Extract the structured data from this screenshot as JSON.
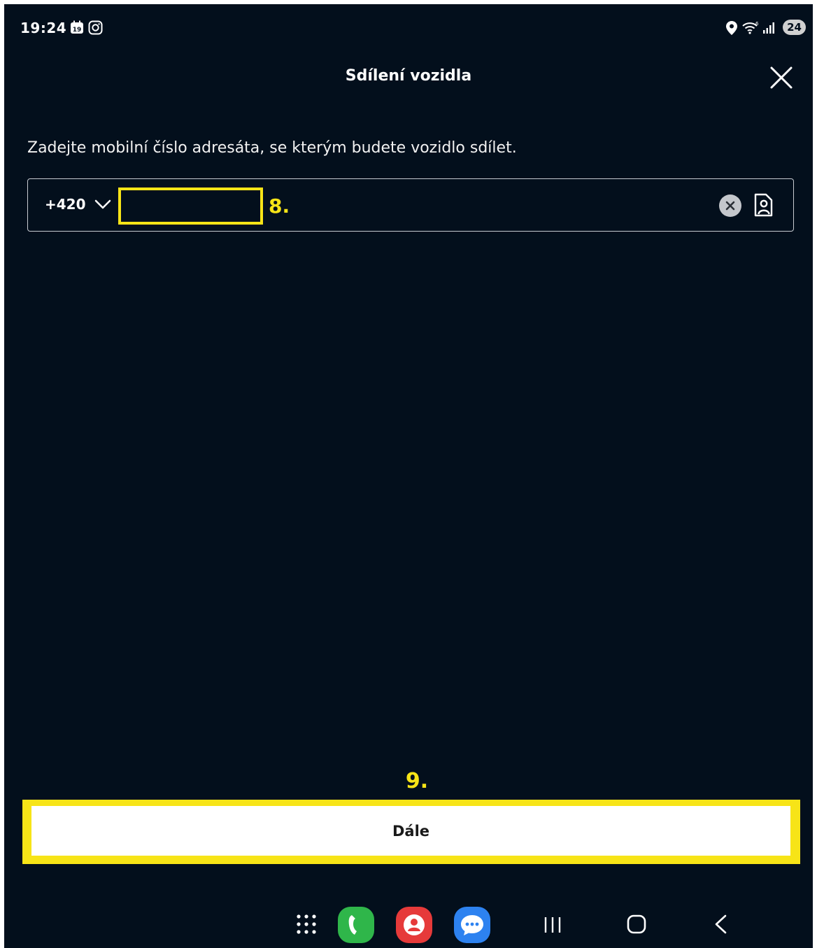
{
  "status_bar": {
    "time": "19:24",
    "calendar_icon_label": "19",
    "battery": "24",
    "icons_left": [
      "calendar-icon",
      "instagram-icon"
    ],
    "icons_right": [
      "location-icon",
      "wifi-icon",
      "signal-icon",
      "battery-icon"
    ]
  },
  "header": {
    "title": "Sdílení vozidla"
  },
  "form": {
    "instruction": "Zadejte mobilní číslo adresáta, se kterým budete vozidlo sdílet.",
    "country_code": "+420",
    "phone_value": "",
    "phone_placeholder": ""
  },
  "annotations": {
    "step_8": "8.",
    "step_9": "9.",
    "highlight_color": "#f7e417"
  },
  "footer": {
    "continue_label": "Dále"
  },
  "nav_bar": {
    "items": [
      "apps-grid-icon",
      "phone-app-icon",
      "contacts-app-icon",
      "messages-app-icon",
      "recents-icon",
      "home-icon",
      "back-icon"
    ]
  }
}
